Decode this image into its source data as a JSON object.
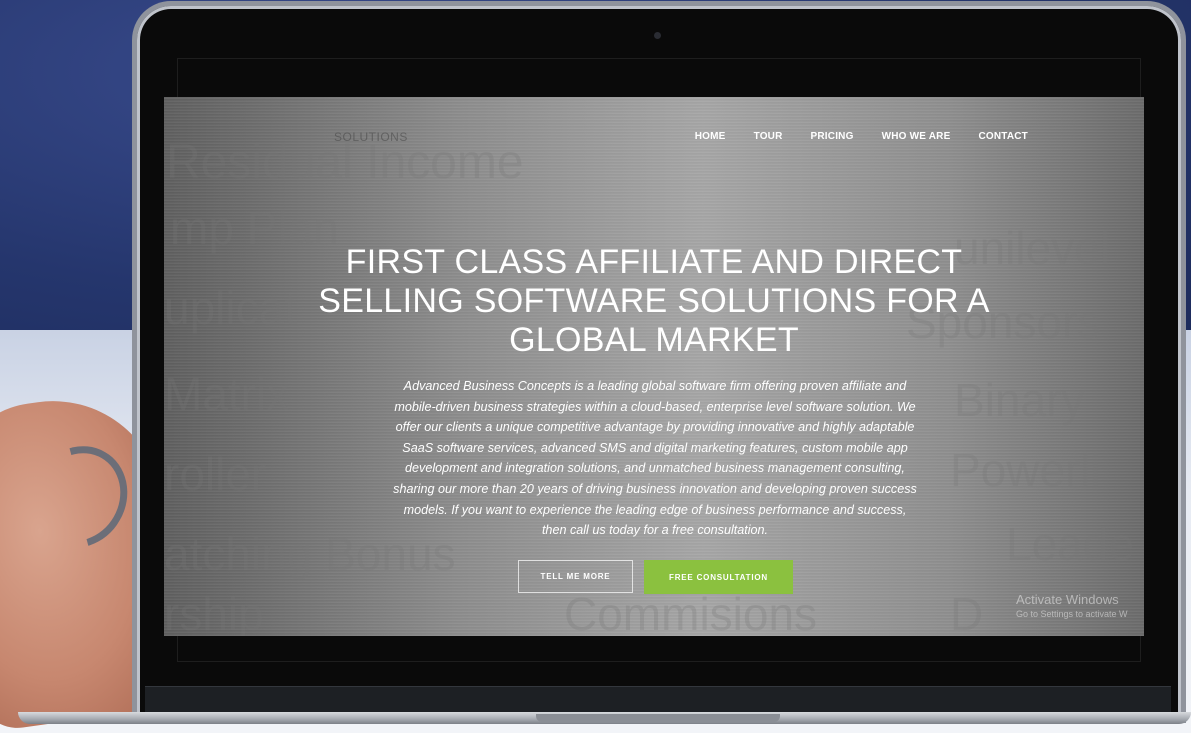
{
  "watermark_words": [
    "Residual Income",
    "mp Plan",
    "uplicat",
    "Matrix",
    "roller",
    "atching Bonus",
    "rship",
    "Commisions",
    "unilevel",
    "Sponsors",
    "Binary",
    "Powerli",
    "Leade",
    "D"
  ],
  "site": {
    "logo_text": "SOLUTIONS",
    "nav": [
      "HOME",
      "TOUR",
      "PRICING",
      "WHO WE ARE",
      "CONTACT"
    ],
    "hero_title": "FIRST CLASS AFFILIATE AND DIRECT SELLING SOFTWARE SOLUTIONS FOR A GLOBAL MARKET",
    "hero_text": "Advanced Business Concepts is a leading global software firm offering proven affiliate and mobile-driven business strategies within a cloud-based, enterprise level software solution. We offer our clients a unique competitive advantage by providing innovative and highly adaptable SaaS software services, advanced SMS and digital marketing features, custom mobile app development and integration solutions, and unmatched business management consulting, sharing our more than 20 years of driving business innovation and developing proven success models. If you want to experience the leading edge of business performance and success, then call us today for a free consultation.",
    "btn_tell_more": "TELL ME MORE",
    "btn_consultation": "FREE CONSULTATION"
  },
  "os_notice": {
    "title": "Activate Windows",
    "subtitle": "Go to Settings to activate W"
  },
  "colors": {
    "accent_green": "#8bc13f",
    "screen_gray": "#8c8c8c"
  }
}
